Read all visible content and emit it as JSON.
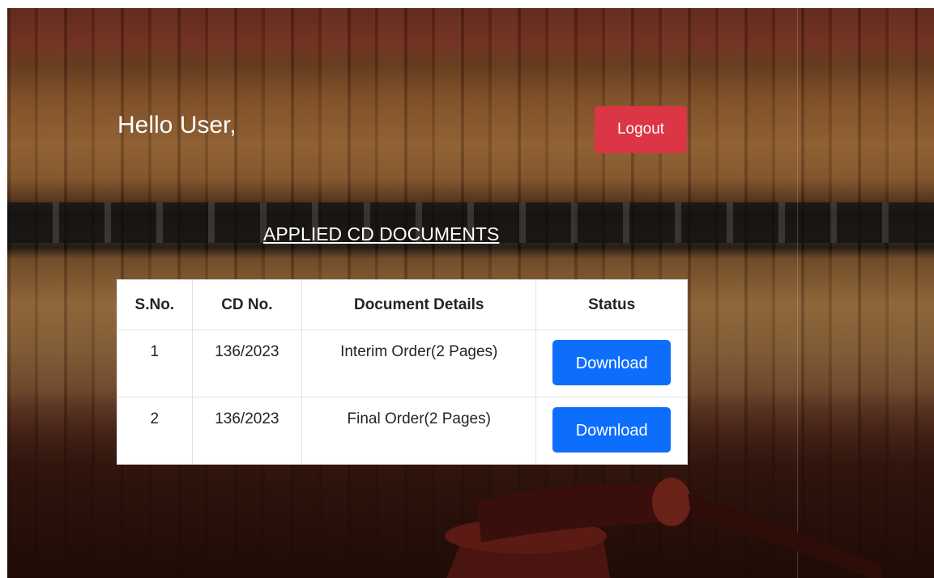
{
  "header": {
    "greeting": "Hello User,",
    "logout_label": "Logout"
  },
  "section": {
    "title": "APPLIED CD DOCUMENTS"
  },
  "table": {
    "columns": [
      "S.No.",
      "CD No.",
      "Document Details",
      "Status"
    ],
    "rows": [
      {
        "sno": "1",
        "cd_no": "136/2023",
        "details": "Interim Order(2 Pages)",
        "action": "Download"
      },
      {
        "sno": "2",
        "cd_no": "136/2023",
        "details": "Final Order(2 Pages)",
        "action": "Download"
      }
    ]
  },
  "colors": {
    "logout": "#dc3545",
    "download": "#0d6efd",
    "background": "#5a2a1a"
  },
  "background_image": "law-library-bookshelf-with-gavel"
}
